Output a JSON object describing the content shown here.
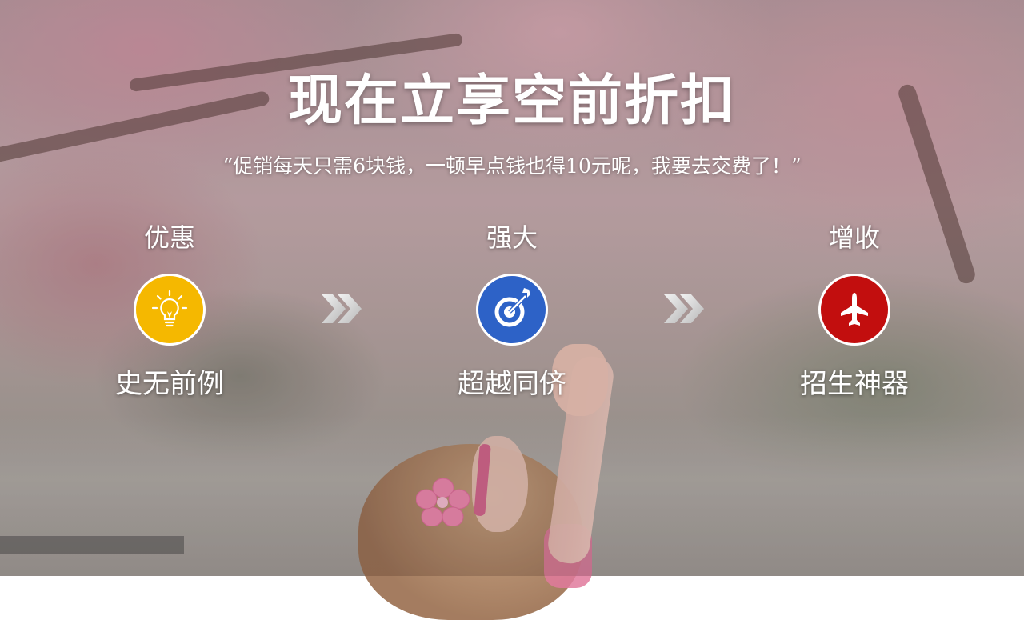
{
  "title": "现在立享空前折扣",
  "quote": "“促销每天只需6块钱，一顿早点钱也得10元呢，我要去交费了！”",
  "steps": [
    {
      "top_label": "优惠",
      "bottom_label": "史无前例",
      "icon": "lightbulb-icon",
      "color": "#f5b800"
    },
    {
      "top_label": "强大",
      "bottom_label": "超越同侪",
      "icon": "target-icon",
      "color": "#2d62c7"
    },
    {
      "top_label": "增收",
      "bottom_label": "招生神器",
      "icon": "airplane-icon",
      "color": "#c20e0e"
    }
  ],
  "arrows": [
    "chevron-double-right-icon",
    "chevron-double-right-icon"
  ]
}
